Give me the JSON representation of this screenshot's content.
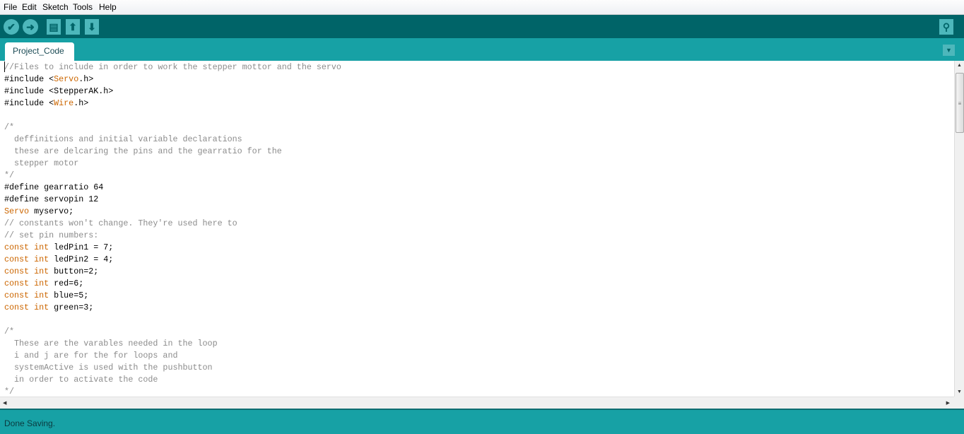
{
  "menu": [
    "File",
    "Edit",
    "Sketch",
    "Tools",
    "Help"
  ],
  "toolbar": {
    "buttons": [
      {
        "name": "verify",
        "icon": "checkmark-icon"
      },
      {
        "name": "upload",
        "icon": "arrow-right-icon"
      },
      {
        "name": "new",
        "icon": "document-icon"
      },
      {
        "name": "open",
        "icon": "arrow-up-icon"
      },
      {
        "name": "save",
        "icon": "arrow-down-icon"
      }
    ],
    "serial_monitor_icon": "magnifier-icon"
  },
  "tab": {
    "label": "Project_Code"
  },
  "colors": {
    "toolbar": "#006468",
    "tabbar": "#17a1a5",
    "button": "#4db7bb",
    "comment": "#8c8c8c",
    "keyword": "#cc6600"
  },
  "code": [
    [
      [
        "//Files to include in order to work the stepper mottor and the servo",
        "c"
      ]
    ],
    [
      [
        "#include <",
        ""
      ],
      [
        "Servo",
        "k"
      ],
      [
        ".h>",
        ""
      ]
    ],
    [
      [
        "#include <StepperAK.h>",
        ""
      ]
    ],
    [
      [
        "#include <",
        ""
      ],
      [
        "Wire",
        "k"
      ],
      [
        ".h>",
        ""
      ]
    ],
    [],
    [
      [
        "/*",
        "c"
      ]
    ],
    [
      [
        "  deffinitions and initial variable declarations",
        "c"
      ]
    ],
    [
      [
        "  these are delcaring the pins and the gearratio for the",
        "c"
      ]
    ],
    [
      [
        "  stepper motor",
        "c"
      ]
    ],
    [
      [
        "*/",
        "c"
      ]
    ],
    [
      [
        "#define gearratio 64",
        ""
      ]
    ],
    [
      [
        "#define servopin 12",
        ""
      ]
    ],
    [
      [
        "Servo",
        "k"
      ],
      [
        " myservo;",
        ""
      ]
    ],
    [
      [
        "// constants won't change. They're used here to",
        "c"
      ]
    ],
    [
      [
        "// set pin numbers:",
        "c"
      ]
    ],
    [
      [
        "const int",
        "k"
      ],
      [
        " ledPin1 = 7;",
        ""
      ]
    ],
    [
      [
        "const int",
        "k"
      ],
      [
        " ledPin2 = 4;",
        ""
      ]
    ],
    [
      [
        "const int",
        "k"
      ],
      [
        " button=2;",
        ""
      ]
    ],
    [
      [
        "const int",
        "k"
      ],
      [
        " red=6;",
        ""
      ]
    ],
    [
      [
        "const int",
        "k"
      ],
      [
        " blue=5;",
        ""
      ]
    ],
    [
      [
        "const int",
        "k"
      ],
      [
        " green=3;",
        ""
      ]
    ],
    [],
    [
      [
        "/*",
        "c"
      ]
    ],
    [
      [
        "  These are the varables needed in the loop",
        "c"
      ]
    ],
    [
      [
        "  i and j are for the for loops and",
        "c"
      ]
    ],
    [
      [
        "  systemActive is used with the pushbutton",
        "c"
      ]
    ],
    [
      [
        "  in order to activate the code",
        "c"
      ]
    ],
    [
      [
        "*/",
        "c"
      ]
    ]
  ],
  "status": {
    "message": "Done Saving."
  }
}
